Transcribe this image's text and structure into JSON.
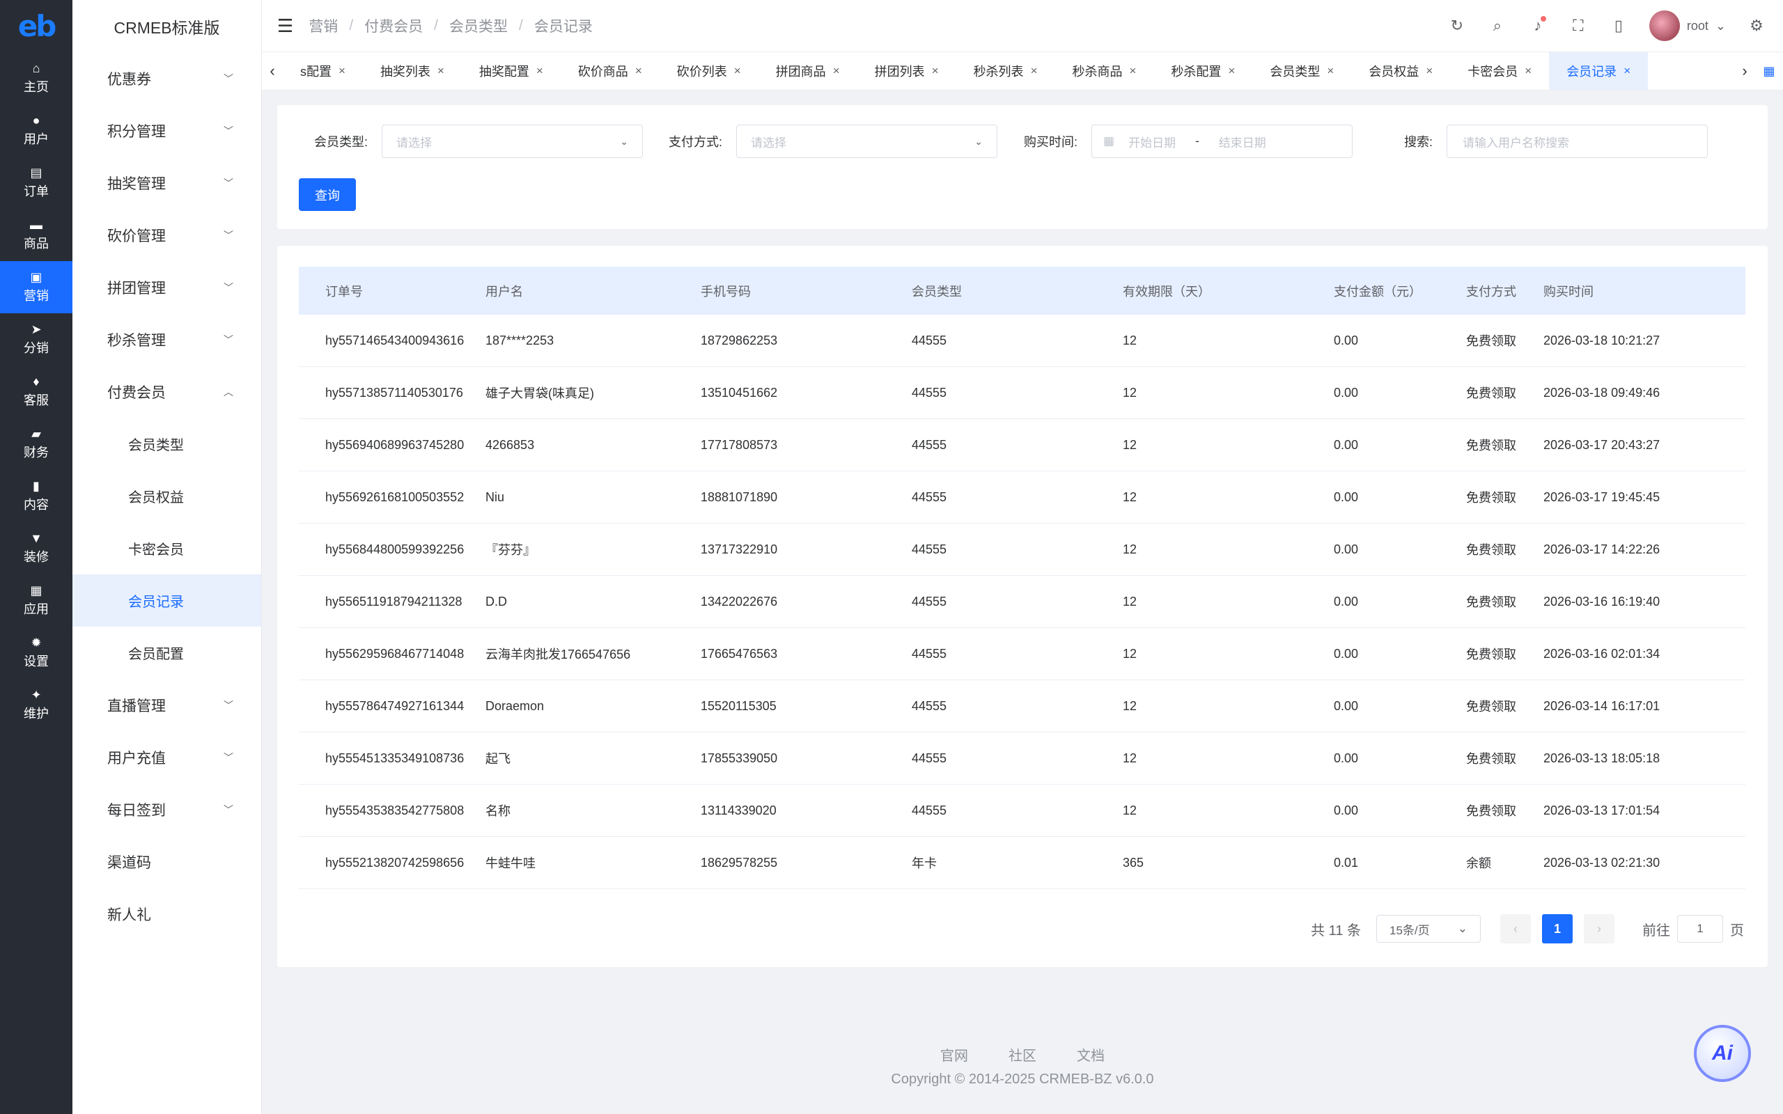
{
  "rail": {
    "logo": "eb",
    "items": [
      {
        "label": "主页",
        "icon": "home-icon",
        "glyph": "⌂"
      },
      {
        "label": "用户",
        "icon": "user-icon",
        "glyph": "●"
      },
      {
        "label": "订单",
        "icon": "order-icon",
        "glyph": "▤"
      },
      {
        "label": "商品",
        "icon": "product-icon",
        "glyph": "▬"
      },
      {
        "label": "营销",
        "icon": "marketing-icon",
        "glyph": "▣"
      },
      {
        "label": "分销",
        "icon": "send-icon",
        "glyph": "➤"
      },
      {
        "label": "客服",
        "icon": "bell-icon",
        "glyph": "♦"
      },
      {
        "label": "财务",
        "icon": "finance-icon",
        "glyph": "▰"
      },
      {
        "label": "内容",
        "icon": "content-icon",
        "glyph": "▮"
      },
      {
        "label": "装修",
        "icon": "decorate-icon",
        "glyph": "▼"
      },
      {
        "label": "应用",
        "icon": "apps-icon",
        "glyph": "▦"
      },
      {
        "label": "设置",
        "icon": "settings-icon",
        "glyph": "✹"
      },
      {
        "label": "维护",
        "icon": "maintain-icon",
        "glyph": "✦"
      }
    ]
  },
  "sidebar": {
    "brand": "CRMEB标准版",
    "items": [
      {
        "label": "优惠券",
        "chev": "﹀"
      },
      {
        "label": "积分管理",
        "chev": "﹀"
      },
      {
        "label": "抽奖管理",
        "chev": "﹀"
      },
      {
        "label": "砍价管理",
        "chev": "﹀"
      },
      {
        "label": "拼团管理",
        "chev": "﹀"
      },
      {
        "label": "秒杀管理",
        "chev": "﹀"
      },
      {
        "label": "付费会员",
        "chev": "︿"
      }
    ],
    "subitems": [
      {
        "label": "会员类型"
      },
      {
        "label": "会员权益"
      },
      {
        "label": "卡密会员"
      },
      {
        "label": "会员记录"
      },
      {
        "label": "会员配置"
      }
    ],
    "items_after": [
      {
        "label": "直播管理",
        "chev": "﹀"
      },
      {
        "label": "用户充值",
        "chev": "﹀"
      },
      {
        "label": "每日签到",
        "chev": "﹀"
      },
      {
        "label": "渠道码",
        "chev": ""
      },
      {
        "label": "新人礼",
        "chev": ""
      }
    ]
  },
  "header": {
    "menu_glyph": "☰",
    "breadcrumb": [
      "营销",
      "付费会员",
      "会员类型",
      "会员记录"
    ],
    "sep": "/",
    "username": "root",
    "icons": {
      "refresh": "↻",
      "search": "⌕",
      "bell": "♪",
      "fullscreen": "⛶",
      "device": "▯",
      "caret": "⌄",
      "gear": "⚙"
    }
  },
  "tabs": {
    "left_arrow": "‹",
    "right_arrow": "›",
    "close": "×",
    "grid": "▦",
    "items": [
      "s配置",
      "抽奖列表",
      "抽奖配置",
      "砍价商品",
      "砍价列表",
      "拼团商品",
      "拼团列表",
      "秒杀列表",
      "秒杀商品",
      "秒杀配置",
      "会员类型",
      "会员权益",
      "卡密会员",
      "会员记录"
    ]
  },
  "filters": {
    "member_type_label": "会员类型:",
    "member_type_placeholder": "请选择",
    "pay_label": "支付方式:",
    "pay_placeholder": "请选择",
    "time_label": "购买时间:",
    "start_placeholder": "开始日期",
    "range_sep": "-",
    "end_placeholder": "结束日期",
    "search_label": "搜索:",
    "search_placeholder": "请输入用户名称搜索",
    "query_button": "查询",
    "caret": "⌄",
    "cal": "▦"
  },
  "table": {
    "headers": [
      "订单号",
      "用户名",
      "手机号码",
      "会员类型",
      "有效期限（天）",
      "支付金额（元）",
      "支付方式",
      "购买时间"
    ],
    "rows": [
      [
        "hy557146543400943616",
        "187****2253",
        "18729862253",
        "44555",
        "12",
        "0.00",
        "免费领取",
        "2026-03-18 10:21:27"
      ],
      [
        "hy557138571140530176",
        "雄子大胃袋(味真足)",
        "13510451662",
        "44555",
        "12",
        "0.00",
        "免费领取",
        "2026-03-18 09:49:46"
      ],
      [
        "hy556940689963745280",
        "4266853",
        "17717808573",
        "44555",
        "12",
        "0.00",
        "免费领取",
        "2026-03-17 20:43:27"
      ],
      [
        "hy556926168100503552",
        "Niu",
        "18881071890",
        "44555",
        "12",
        "0.00",
        "免费领取",
        "2026-03-17 19:45:45"
      ],
      [
        "hy556844800599392256",
        "『芬芬』",
        "13717322910",
        "44555",
        "12",
        "0.00",
        "免费领取",
        "2026-03-17 14:22:26"
      ],
      [
        "hy556511918794211328",
        "D.D",
        "13422022676",
        "44555",
        "12",
        "0.00",
        "免费领取",
        "2026-03-16 16:19:40"
      ],
      [
        "hy556295968467714048",
        "云海羊肉批发1766547656",
        "17665476563",
        "44555",
        "12",
        "0.00",
        "免费领取",
        "2026-03-16 02:01:34"
      ],
      [
        "hy555786474927161344",
        "Doraemon",
        "15520115305",
        "44555",
        "12",
        "0.00",
        "免费领取",
        "2026-03-14 16:17:01"
      ],
      [
        "hy555451335349108736",
        "起飞",
        "17855339050",
        "44555",
        "12",
        "0.00",
        "免费领取",
        "2026-03-13 18:05:18"
      ],
      [
        "hy555435383542775808",
        "名称",
        "13114339020",
        "44555",
        "12",
        "0.00",
        "免费领取",
        "2026-03-13 17:01:54"
      ],
      [
        "hy555213820742598656",
        "牛蛙牛哇",
        "18629578255",
        "年卡",
        "365",
        "0.01",
        "余额",
        "2026-03-13 02:21:30"
      ]
    ]
  },
  "pagination": {
    "total": "共 11 条",
    "page_size": "15条/页",
    "prev": "‹",
    "next": "›",
    "current": "1",
    "goto_label": "前往",
    "goto_value": "1",
    "page_suffix": "页"
  },
  "footer": {
    "links": [
      "官网",
      "社区",
      "文档"
    ],
    "copyright": "Copyright © 2014-2025 CRMEB-BZ v6.0.0"
  },
  "ai_label": "Ai",
  "colors": {
    "primary": "#1a6bff",
    "rail_bg": "#282c34"
  }
}
